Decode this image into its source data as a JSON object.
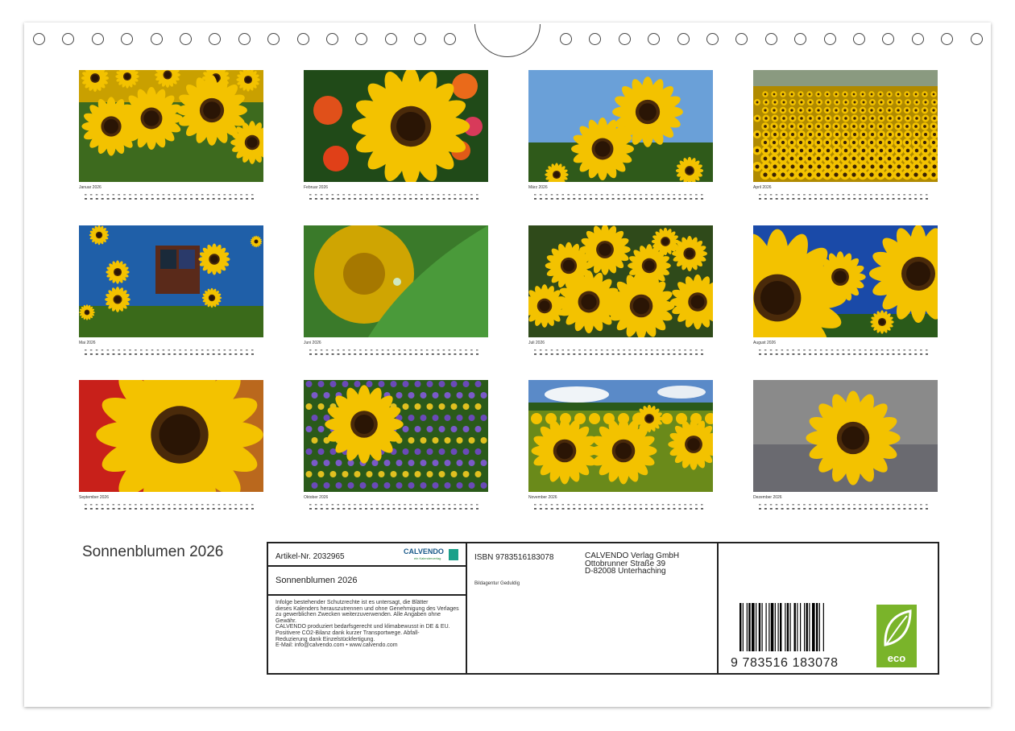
{
  "calendar": {
    "months": [
      {
        "label": "Januar 2026",
        "scene": "field-close"
      },
      {
        "label": "Februar 2026",
        "scene": "single-flowers"
      },
      {
        "label": "März 2026",
        "scene": "sky-pair"
      },
      {
        "label": "April 2026",
        "scene": "wide-field"
      },
      {
        "label": "Mai 2026",
        "scene": "blue-house"
      },
      {
        "label": "Juni 2026",
        "scene": "dew-leaf"
      },
      {
        "label": "Juli 2026",
        "scene": "dense-bunch"
      },
      {
        "label": "August 2026",
        "scene": "sky-petals"
      },
      {
        "label": "September 2026",
        "scene": "macro-bee"
      },
      {
        "label": "Oktober 2026",
        "scene": "wildflowers"
      },
      {
        "label": "November 2026",
        "scene": "clouds-field"
      },
      {
        "label": "Dezember 2026",
        "scene": "grey-single"
      }
    ]
  },
  "cover_title": "Sonnenblumen 2026",
  "info": {
    "article": "Artikel-Nr. 2032965",
    "brand": "CALVENDO",
    "brand_sub": "ein Kalenderverlag",
    "title": "Sonnenblumen 2026",
    "legal": [
      "Infolge bestehender Schutzrechte ist es untersagt, die Blätter",
      "dieses Kalenders herauszutrennen und ohne Genehmigung des Verlages",
      "zu gewerblichen Zwecken weiterzuverwenden. Alle Angaben ohne",
      "Gewähr.",
      "CALVENDO produziert bedarfsgerecht und klimabewusst in DE & EU.",
      "Positivere CO2-Bilanz dank kurzer Transportwege. Abfall-",
      "Reduzierung dank Einzelstückfertigung.",
      "E-Mail: info@calvendo.com • www.calvendo.com"
    ],
    "isbn": "ISBN 9783516183078",
    "agency": "Bildagentur Geduldig",
    "publisher": [
      "CALVENDO Verlag GmbH",
      "Ottobrunner Straße 39",
      "D-82008 Unterhaching"
    ],
    "barcode_number": "9 783516 183078",
    "eco_label": "eco"
  },
  "colors": {
    "sunflower": "#f3c200",
    "center": "#4a2a0a",
    "leaf": "#2f6a1a",
    "eco_green": "#7ab42a"
  }
}
